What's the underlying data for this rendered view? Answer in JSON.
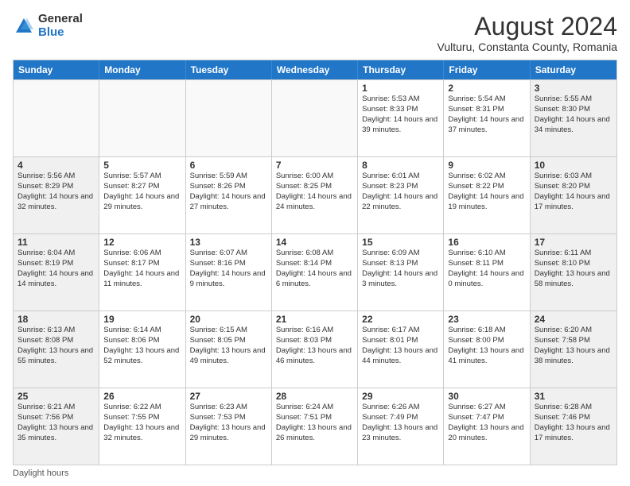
{
  "logo": {
    "general": "General",
    "blue": "Blue"
  },
  "title": "August 2024",
  "subtitle": "Vulturu, Constanta County, Romania",
  "header_days": [
    "Sunday",
    "Monday",
    "Tuesday",
    "Wednesday",
    "Thursday",
    "Friday",
    "Saturday"
  ],
  "weeks": [
    [
      {
        "day": "",
        "info": ""
      },
      {
        "day": "",
        "info": ""
      },
      {
        "day": "",
        "info": ""
      },
      {
        "day": "",
        "info": ""
      },
      {
        "day": "1",
        "info": "Sunrise: 5:53 AM\nSunset: 8:33 PM\nDaylight: 14 hours\nand 39 minutes."
      },
      {
        "day": "2",
        "info": "Sunrise: 5:54 AM\nSunset: 8:31 PM\nDaylight: 14 hours\nand 37 minutes."
      },
      {
        "day": "3",
        "info": "Sunrise: 5:55 AM\nSunset: 8:30 PM\nDaylight: 14 hours\nand 34 minutes."
      }
    ],
    [
      {
        "day": "4",
        "info": "Sunrise: 5:56 AM\nSunset: 8:29 PM\nDaylight: 14 hours\nand 32 minutes."
      },
      {
        "day": "5",
        "info": "Sunrise: 5:57 AM\nSunset: 8:27 PM\nDaylight: 14 hours\nand 29 minutes."
      },
      {
        "day": "6",
        "info": "Sunrise: 5:59 AM\nSunset: 8:26 PM\nDaylight: 14 hours\nand 27 minutes."
      },
      {
        "day": "7",
        "info": "Sunrise: 6:00 AM\nSunset: 8:25 PM\nDaylight: 14 hours\nand 24 minutes."
      },
      {
        "day": "8",
        "info": "Sunrise: 6:01 AM\nSunset: 8:23 PM\nDaylight: 14 hours\nand 22 minutes."
      },
      {
        "day": "9",
        "info": "Sunrise: 6:02 AM\nSunset: 8:22 PM\nDaylight: 14 hours\nand 19 minutes."
      },
      {
        "day": "10",
        "info": "Sunrise: 6:03 AM\nSunset: 8:20 PM\nDaylight: 14 hours\nand 17 minutes."
      }
    ],
    [
      {
        "day": "11",
        "info": "Sunrise: 6:04 AM\nSunset: 8:19 PM\nDaylight: 14 hours\nand 14 minutes."
      },
      {
        "day": "12",
        "info": "Sunrise: 6:06 AM\nSunset: 8:17 PM\nDaylight: 14 hours\nand 11 minutes."
      },
      {
        "day": "13",
        "info": "Sunrise: 6:07 AM\nSunset: 8:16 PM\nDaylight: 14 hours\nand 9 minutes."
      },
      {
        "day": "14",
        "info": "Sunrise: 6:08 AM\nSunset: 8:14 PM\nDaylight: 14 hours\nand 6 minutes."
      },
      {
        "day": "15",
        "info": "Sunrise: 6:09 AM\nSunset: 8:13 PM\nDaylight: 14 hours\nand 3 minutes."
      },
      {
        "day": "16",
        "info": "Sunrise: 6:10 AM\nSunset: 8:11 PM\nDaylight: 14 hours\nand 0 minutes."
      },
      {
        "day": "17",
        "info": "Sunrise: 6:11 AM\nSunset: 8:10 PM\nDaylight: 13 hours\nand 58 minutes."
      }
    ],
    [
      {
        "day": "18",
        "info": "Sunrise: 6:13 AM\nSunset: 8:08 PM\nDaylight: 13 hours\nand 55 minutes."
      },
      {
        "day": "19",
        "info": "Sunrise: 6:14 AM\nSunset: 8:06 PM\nDaylight: 13 hours\nand 52 minutes."
      },
      {
        "day": "20",
        "info": "Sunrise: 6:15 AM\nSunset: 8:05 PM\nDaylight: 13 hours\nand 49 minutes."
      },
      {
        "day": "21",
        "info": "Sunrise: 6:16 AM\nSunset: 8:03 PM\nDaylight: 13 hours\nand 46 minutes."
      },
      {
        "day": "22",
        "info": "Sunrise: 6:17 AM\nSunset: 8:01 PM\nDaylight: 13 hours\nand 44 minutes."
      },
      {
        "day": "23",
        "info": "Sunrise: 6:18 AM\nSunset: 8:00 PM\nDaylight: 13 hours\nand 41 minutes."
      },
      {
        "day": "24",
        "info": "Sunrise: 6:20 AM\nSunset: 7:58 PM\nDaylight: 13 hours\nand 38 minutes."
      }
    ],
    [
      {
        "day": "25",
        "info": "Sunrise: 6:21 AM\nSunset: 7:56 PM\nDaylight: 13 hours\nand 35 minutes."
      },
      {
        "day": "26",
        "info": "Sunrise: 6:22 AM\nSunset: 7:55 PM\nDaylight: 13 hours\nand 32 minutes."
      },
      {
        "day": "27",
        "info": "Sunrise: 6:23 AM\nSunset: 7:53 PM\nDaylight: 13 hours\nand 29 minutes."
      },
      {
        "day": "28",
        "info": "Sunrise: 6:24 AM\nSunset: 7:51 PM\nDaylight: 13 hours\nand 26 minutes."
      },
      {
        "day": "29",
        "info": "Sunrise: 6:26 AM\nSunset: 7:49 PM\nDaylight: 13 hours\nand 23 minutes."
      },
      {
        "day": "30",
        "info": "Sunrise: 6:27 AM\nSunset: 7:47 PM\nDaylight: 13 hours\nand 20 minutes."
      },
      {
        "day": "31",
        "info": "Sunrise: 6:28 AM\nSunset: 7:46 PM\nDaylight: 13 hours\nand 17 minutes."
      }
    ]
  ],
  "footer": "Daylight hours"
}
